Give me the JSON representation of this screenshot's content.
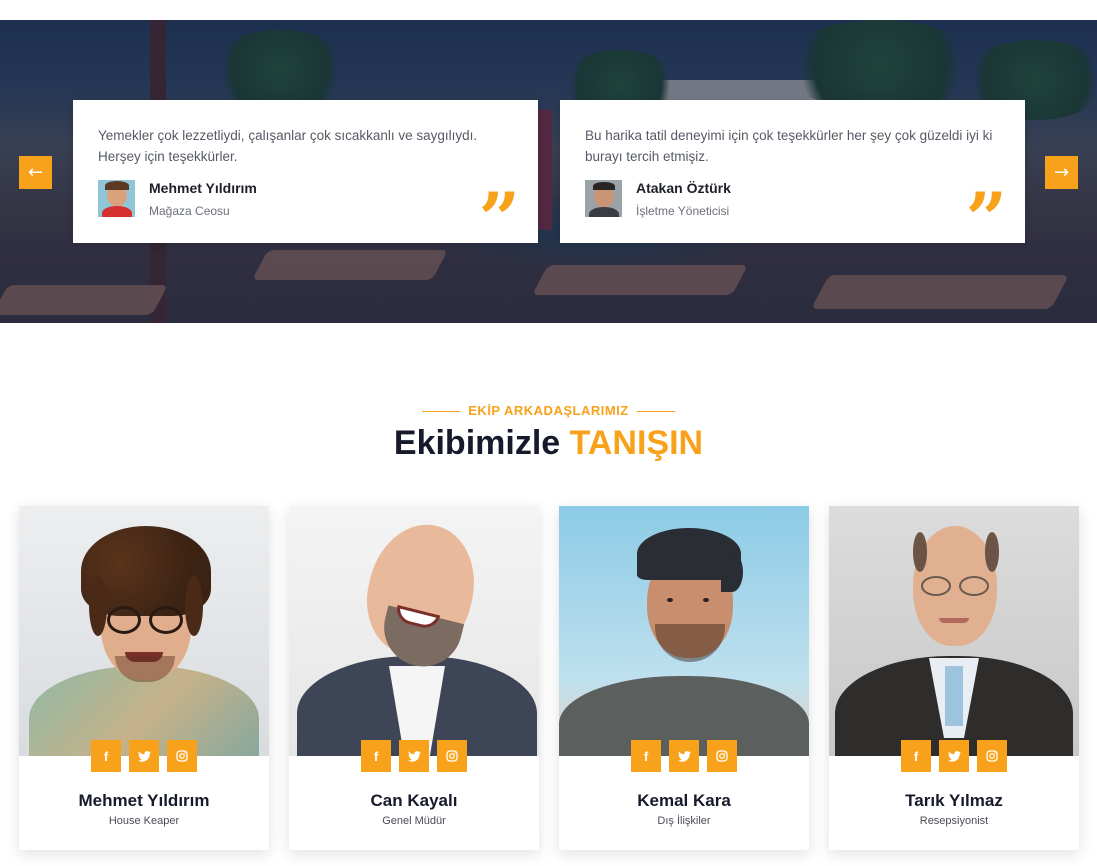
{
  "testimonials": {
    "prev_icon": "arrow-left-icon",
    "next_icon": "arrow-right-icon",
    "items": [
      {
        "quote": "Yemekler çok lezzetliydi, çalışanlar çok sıcakkanlı ve saygılıydı. Herşey için teşekkürler.",
        "name": "Mehmet Yıldırım",
        "role": "Mağaza Ceosu"
      },
      {
        "quote": "Bu harika tatil deneyimi için çok teşekkürler her şey çok güzeldi iyi ki burayı tercih etmişiz.",
        "name": "Atakan Öztürk",
        "role": "İşletme Yöneticisi"
      }
    ]
  },
  "team_section": {
    "eyebrow": "EKİP ARKADAŞLARIMIZ",
    "title_main": "Ekibimizle ",
    "title_accent": "TANIŞIN",
    "members": [
      {
        "name": "Mehmet Yıldırım",
        "role": "House Keaper"
      },
      {
        "name": "Can Kayalı",
        "role": "Genel Müdür"
      },
      {
        "name": "Kemal Kara",
        "role": "Dış İlişkiler"
      },
      {
        "name": "Tarık Yılmaz",
        "role": "Resepsiyonist"
      }
    ],
    "social": [
      "facebook-icon",
      "twitter-icon",
      "instagram-icon"
    ]
  },
  "colors": {
    "accent": "#f8a21c",
    "heading": "#161a2b",
    "overlay": "#16223e"
  }
}
